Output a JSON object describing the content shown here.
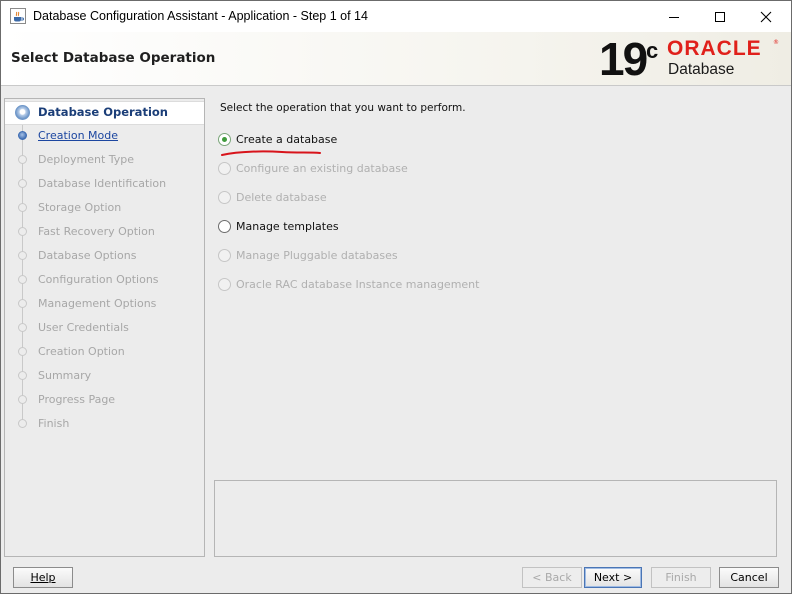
{
  "window": {
    "title": "Database Configuration Assistant - Application - Step 1 of 14",
    "app_icon": "java-cup-icon"
  },
  "header": {
    "title": "Select Database Operation",
    "logo": {
      "version": "19",
      "version_suffix": "c",
      "brand": "ORACLE",
      "product": "Database",
      "brand_color": "#e0201b"
    }
  },
  "nav": {
    "items": [
      {
        "label": "Database Operation",
        "state": "current"
      },
      {
        "label": "Creation Mode",
        "state": "next"
      },
      {
        "label": "Deployment Type",
        "state": "disabled"
      },
      {
        "label": "Database Identification",
        "state": "disabled"
      },
      {
        "label": "Storage Option",
        "state": "disabled"
      },
      {
        "label": "Fast Recovery Option",
        "state": "disabled"
      },
      {
        "label": "Database Options",
        "state": "disabled"
      },
      {
        "label": "Configuration Options",
        "state": "disabled"
      },
      {
        "label": "Management Options",
        "state": "disabled"
      },
      {
        "label": "User Credentials",
        "state": "disabled"
      },
      {
        "label": "Creation Option",
        "state": "disabled"
      },
      {
        "label": "Summary",
        "state": "disabled"
      },
      {
        "label": "Progress Page",
        "state": "disabled"
      },
      {
        "label": "Finish",
        "state": "disabled"
      }
    ]
  },
  "main": {
    "prompt": "Select the operation that you want to perform.",
    "options": [
      {
        "label": "Create a database",
        "selected": true,
        "enabled": true
      },
      {
        "label": "Configure an existing database",
        "selected": false,
        "enabled": false
      },
      {
        "label": "Delete database",
        "selected": false,
        "enabled": false
      },
      {
        "label": "Manage templates",
        "selected": false,
        "enabled": true
      },
      {
        "label": "Manage Pluggable databases",
        "selected": false,
        "enabled": false
      },
      {
        "label": "Oracle RAC database Instance management",
        "selected": false,
        "enabled": false
      }
    ],
    "annotation_color": "#d8141b"
  },
  "buttons": {
    "help": "Help",
    "back": "< Back",
    "next": "Next >",
    "finish": "Finish",
    "cancel": "Cancel"
  }
}
